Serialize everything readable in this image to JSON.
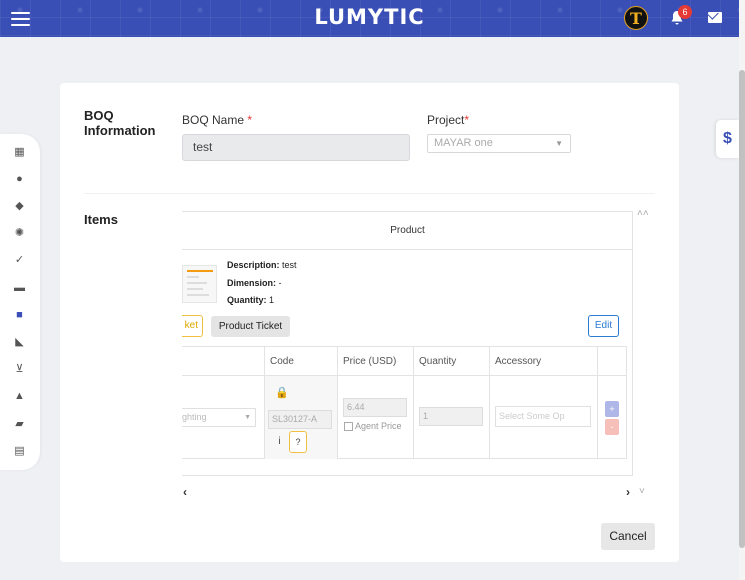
{
  "header": {
    "logo": "LUMYTIC",
    "avatar_letter": "T",
    "notification_count": "6"
  },
  "sidebar_icons": [
    "dashboard-icon",
    "user-icon",
    "box-icon",
    "settings-gear-icon",
    "check-circle-icon",
    "archive-icon",
    "briefcase-icon",
    "tag-icon",
    "cart-icon",
    "warehouse-icon",
    "truck-icon",
    "invoice-icon"
  ],
  "dollar_tab": "$",
  "boq_section": {
    "title": "BOQ Information",
    "name_label": "BOQ Name",
    "name_required": "*",
    "name_value": "test",
    "project_label": "Project",
    "project_required": "*",
    "project_value": "MAYAR one"
  },
  "items_section": {
    "title": "Items",
    "product_header": "Product",
    "description_label": "Description:",
    "description_value": "test",
    "dimension_label": "Dimension:",
    "dimension_value": "-",
    "quantity_label": "Quantity:",
    "quantity_value": "1",
    "ticket_partial": "ket",
    "product_ticket_button": "Product Ticket",
    "edit_button": "Edit",
    "columns": [
      "Code",
      "Price (USD)",
      "Quantity",
      "Accessory"
    ],
    "row": {
      "type_value": "ghting",
      "code_value": "SL30127-A",
      "price_value": "6.44",
      "agent_price_label": "Agent Price",
      "quantity_value": "1",
      "accessory_placeholder": "Select Some Op",
      "info_glyph": "i",
      "help_glyph": "?",
      "add_glyph": "+",
      "remove_glyph": "-"
    }
  },
  "footer": {
    "cancel_button": "Cancel"
  },
  "colors": {
    "brand": "#3a4fb6",
    "required": "#e53935",
    "edit": "#2a7bd2",
    "ticket": "#f0c040"
  }
}
